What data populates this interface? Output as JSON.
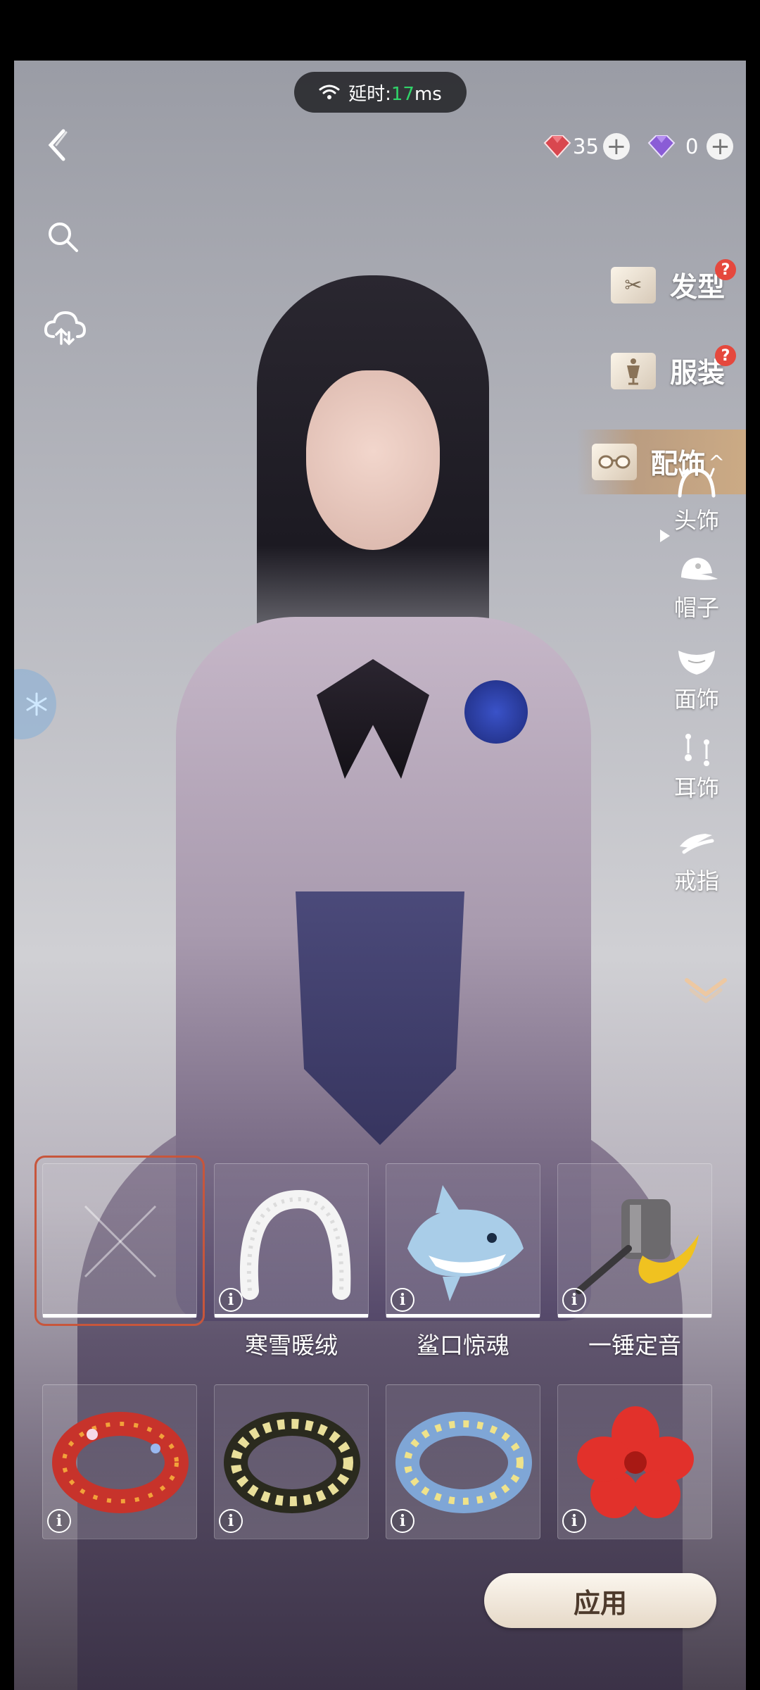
{
  "status": {
    "latency_label": "延时:",
    "latency_value": "17",
    "latency_unit": "ms"
  },
  "currency": [
    {
      "name": "red-crystal",
      "amount": "35",
      "color": "#d9474f"
    },
    {
      "name": "purple-crystal",
      "amount": "0",
      "color": "#8a5cd6"
    }
  ],
  "categories": [
    {
      "label": "发型",
      "icon": "scissors-icon",
      "badge": "?"
    },
    {
      "label": "服装",
      "icon": "mannequin-icon",
      "badge": "?"
    },
    {
      "label": "配饰",
      "icon": "glasses-icon",
      "active": true
    }
  ],
  "subcategories": [
    {
      "label": "头饰",
      "icon": "headband-icon",
      "selected": true
    },
    {
      "label": "帽子",
      "icon": "cap-icon"
    },
    {
      "label": "面饰",
      "icon": "mask-icon"
    },
    {
      "label": "耳饰",
      "icon": "earring-icon"
    },
    {
      "label": "戒指",
      "icon": "ring-icon"
    }
  ],
  "items": [
    {
      "name": "",
      "art": "none-icon",
      "selected": true
    },
    {
      "name": "寒雪暖绒",
      "art": "white-fluffy-headband"
    },
    {
      "name": "鲨口惊魂",
      "art": "shark-hairclip"
    },
    {
      "name": "一锤定音",
      "art": "hammer-hairpin"
    },
    {
      "name": "",
      "art": "red-flower-wreath"
    },
    {
      "name": "",
      "art": "yellow-flower-wreath"
    },
    {
      "name": "",
      "art": "blue-flower-wreath"
    },
    {
      "name": "",
      "art": "red-hibiscus"
    }
  ],
  "actions": {
    "apply_label": "应用"
  },
  "info_glyph": "i",
  "plus_glyph": "+",
  "accent": "#c7563c"
}
